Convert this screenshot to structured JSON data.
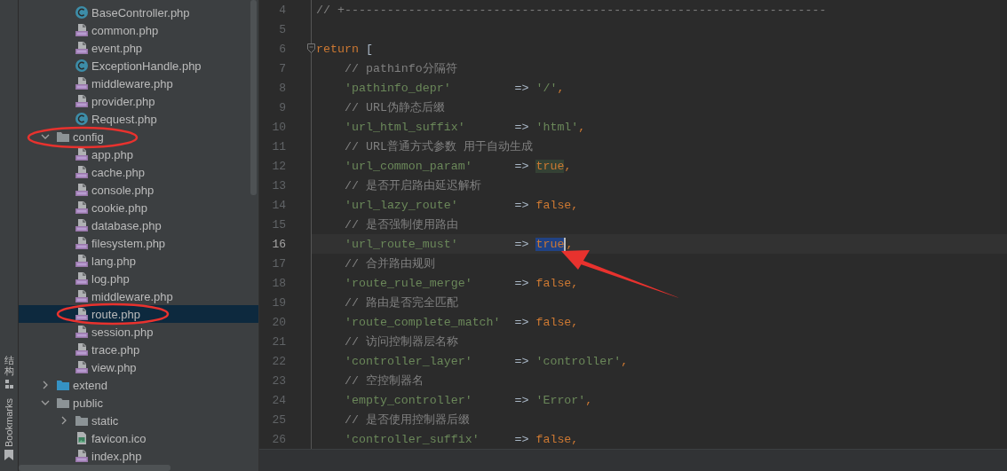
{
  "side_strip": {
    "labels": [
      {
        "text": "结构",
        "kind": "structure"
      },
      {
        "text": "Bookmarks",
        "kind": "bookmarks"
      }
    ]
  },
  "project_tree": {
    "continued_items": [
      {
        "name": "BaseController.php",
        "kind": "class",
        "selected": false
      },
      {
        "name": "common.php",
        "kind": "php",
        "selected": false
      },
      {
        "name": "event.php",
        "kind": "php",
        "selected": false
      },
      {
        "name": "ExceptionHandle.php",
        "kind": "class",
        "selected": false
      },
      {
        "name": "middleware.php",
        "kind": "php",
        "selected": false
      },
      {
        "name": "provider.php",
        "kind": "php",
        "selected": false
      },
      {
        "name": "Request.php",
        "kind": "class",
        "selected": false
      }
    ],
    "items": [
      {
        "name": "config",
        "kind": "folder",
        "color": "#8c9396",
        "expanded": true,
        "selected": false,
        "children": [
          {
            "name": "app.php",
            "kind": "php",
            "selected": false
          },
          {
            "name": "cache.php",
            "kind": "php",
            "selected": false
          },
          {
            "name": "console.php",
            "kind": "php",
            "selected": false
          },
          {
            "name": "cookie.php",
            "kind": "php",
            "selected": false
          },
          {
            "name": "database.php",
            "kind": "php",
            "selected": false
          },
          {
            "name": "filesystem.php",
            "kind": "php",
            "selected": false
          },
          {
            "name": "lang.php",
            "kind": "php",
            "selected": false
          },
          {
            "name": "log.php",
            "kind": "php",
            "selected": false
          },
          {
            "name": "middleware.php",
            "kind": "php",
            "selected": false
          },
          {
            "name": "route.php",
            "kind": "php",
            "selected": true
          },
          {
            "name": "session.php",
            "kind": "php",
            "selected": false
          },
          {
            "name": "trace.php",
            "kind": "php",
            "selected": false
          },
          {
            "name": "view.php",
            "kind": "php",
            "selected": false
          }
        ]
      },
      {
        "name": "extend",
        "kind": "folder",
        "color": "#3592c4",
        "expanded": false,
        "selected": false
      },
      {
        "name": "public",
        "kind": "folder",
        "color": "#8c9396",
        "expanded": true,
        "selected": false,
        "children": [
          {
            "name": "static",
            "kind": "folder",
            "color": "#8c9396",
            "expanded": false,
            "selected": false
          },
          {
            "name": "favicon.ico",
            "kind": "image",
            "selected": false
          },
          {
            "name": "index.php",
            "kind": "php",
            "selected": false
          }
        ]
      }
    ]
  },
  "editor": {
    "lines": [
      {
        "number": "4",
        "kind": "comment",
        "text": "// +--------------------------------------------------------------------",
        "current": false
      },
      {
        "number": "5",
        "kind": "blank",
        "current": false
      },
      {
        "number": "6",
        "kind": "return",
        "keyword": "return",
        "bracket": "[",
        "foldable": true,
        "current": false
      },
      {
        "number": "7",
        "kind": "comment",
        "text": "// pathinfo分隔符",
        "current": false
      },
      {
        "number": "8",
        "kind": "entry",
        "key": "'pathinfo_depr'",
        "arrow": "=>",
        "value": {
          "text": "'/'",
          "kind": "string",
          "highlighted": false,
          "selected": false
        },
        "comma": ",",
        "current": false
      },
      {
        "number": "9",
        "kind": "comment",
        "text": "// URL伪静态后缀",
        "current": false
      },
      {
        "number": "10",
        "kind": "entry",
        "key": "'url_html_suffix'",
        "arrow": "=>",
        "value": {
          "text": "'html'",
          "kind": "string",
          "highlighted": false,
          "selected": false
        },
        "comma": ",",
        "current": false
      },
      {
        "number": "11",
        "kind": "comment",
        "text": "// URL普通方式参数 用于自动生成",
        "current": false
      },
      {
        "number": "12",
        "kind": "entry",
        "key": "'url_common_param'",
        "arrow": "=>",
        "value": {
          "text": "true",
          "kind": "keyword",
          "highlighted": true,
          "selected": false
        },
        "comma": ",",
        "current": false
      },
      {
        "number": "13",
        "kind": "comment",
        "text": "// 是否开启路由延迟解析",
        "current": false
      },
      {
        "number": "14",
        "kind": "entry",
        "key": "'url_lazy_route'",
        "arrow": "=>",
        "value": {
          "text": "false",
          "kind": "keyword",
          "highlighted": false,
          "selected": false
        },
        "comma": ",",
        "current": false
      },
      {
        "number": "15",
        "kind": "comment",
        "text": "// 是否强制使用路由",
        "current": false
      },
      {
        "number": "16",
        "kind": "entry",
        "key": "'url_route_must'",
        "arrow": "=>",
        "value": {
          "text": "true",
          "kind": "keyword",
          "highlighted": false,
          "selected": true
        },
        "comma": ",",
        "current": true
      },
      {
        "number": "17",
        "kind": "comment",
        "text": "// 合并路由规则",
        "current": false
      },
      {
        "number": "18",
        "kind": "entry",
        "key": "'route_rule_merge'",
        "arrow": "=>",
        "value": {
          "text": "false",
          "kind": "keyword",
          "highlighted": false,
          "selected": false
        },
        "comma": ",",
        "current": false
      },
      {
        "number": "19",
        "kind": "comment",
        "text": "// 路由是否完全匹配",
        "current": false
      },
      {
        "number": "20",
        "kind": "entry",
        "key": "'route_complete_match'",
        "arrow": "=>",
        "value": {
          "text": "false",
          "kind": "keyword",
          "highlighted": false,
          "selected": false
        },
        "comma": ",",
        "current": false
      },
      {
        "number": "21",
        "kind": "comment",
        "text": "// 访问控制器层名称",
        "current": false
      },
      {
        "number": "22",
        "kind": "entry",
        "key": "'controller_layer'",
        "arrow": "=>",
        "value": {
          "text": "'controller'",
          "kind": "string",
          "highlighted": false,
          "selected": false
        },
        "comma": ",",
        "current": false
      },
      {
        "number": "23",
        "kind": "comment",
        "text": "// 空控制器名",
        "current": false
      },
      {
        "number": "24",
        "kind": "entry",
        "key": "'empty_controller'",
        "arrow": "=>",
        "value": {
          "text": "'Error'",
          "kind": "string",
          "highlighted": false,
          "selected": false
        },
        "comma": ",",
        "current": false
      },
      {
        "number": "25",
        "kind": "comment",
        "text": "// 是否使用控制器后缀",
        "current": false
      },
      {
        "number": "26",
        "kind": "entry",
        "key": "'controller_suffix'",
        "arrow": "=>",
        "value": {
          "text": "false",
          "kind": "keyword",
          "highlighted": false,
          "selected": false
        },
        "comma": ",",
        "current": false
      }
    ]
  }
}
